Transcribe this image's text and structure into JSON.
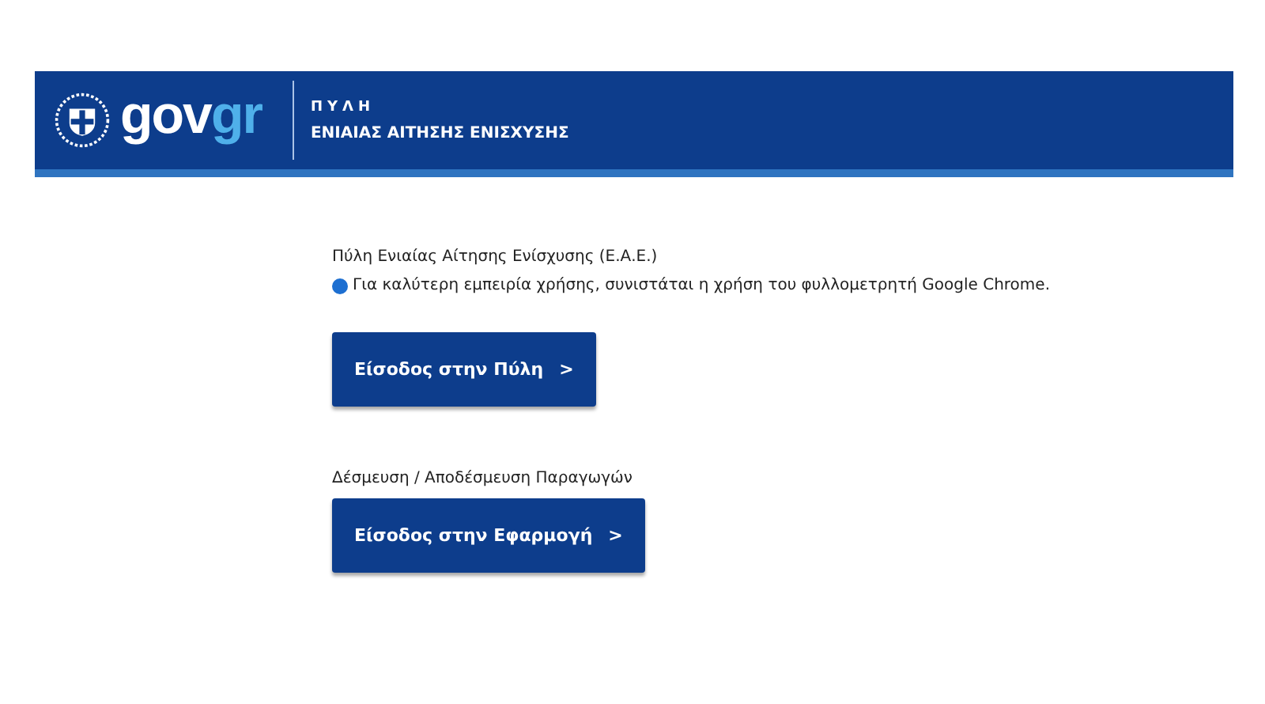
{
  "header": {
    "logo": [
      {
        "text": "gov",
        "accent": false
      },
      {
        "text": "gr",
        "accent": true
      }
    ],
    "subtitle": "ΠΥΛΗ",
    "title": "ΕΝΙΑΙΑΣ ΑΙΤΗΣΗΣ ΕΝΙΣΧΥΣΗΣ"
  },
  "sections": [
    {
      "heading": "Πύλη Ενιαίας Αίτησης Ενίσχυσης (Ε.Α.Ε.)",
      "info": "Για καλύτερη εμπειρία χρήσης, συνιστάται η χρήση του φυλλομετρητή Google Chrome.",
      "button": {
        "label": "Είσοδος στην Πύλη",
        "chevron": ">"
      }
    },
    {
      "heading": "Δέσμευση / Αποδέσμευση Παραγωγών",
      "button": {
        "label": "Είσοδος στην Εφαρμογή",
        "chevron": ">"
      }
    }
  ]
}
